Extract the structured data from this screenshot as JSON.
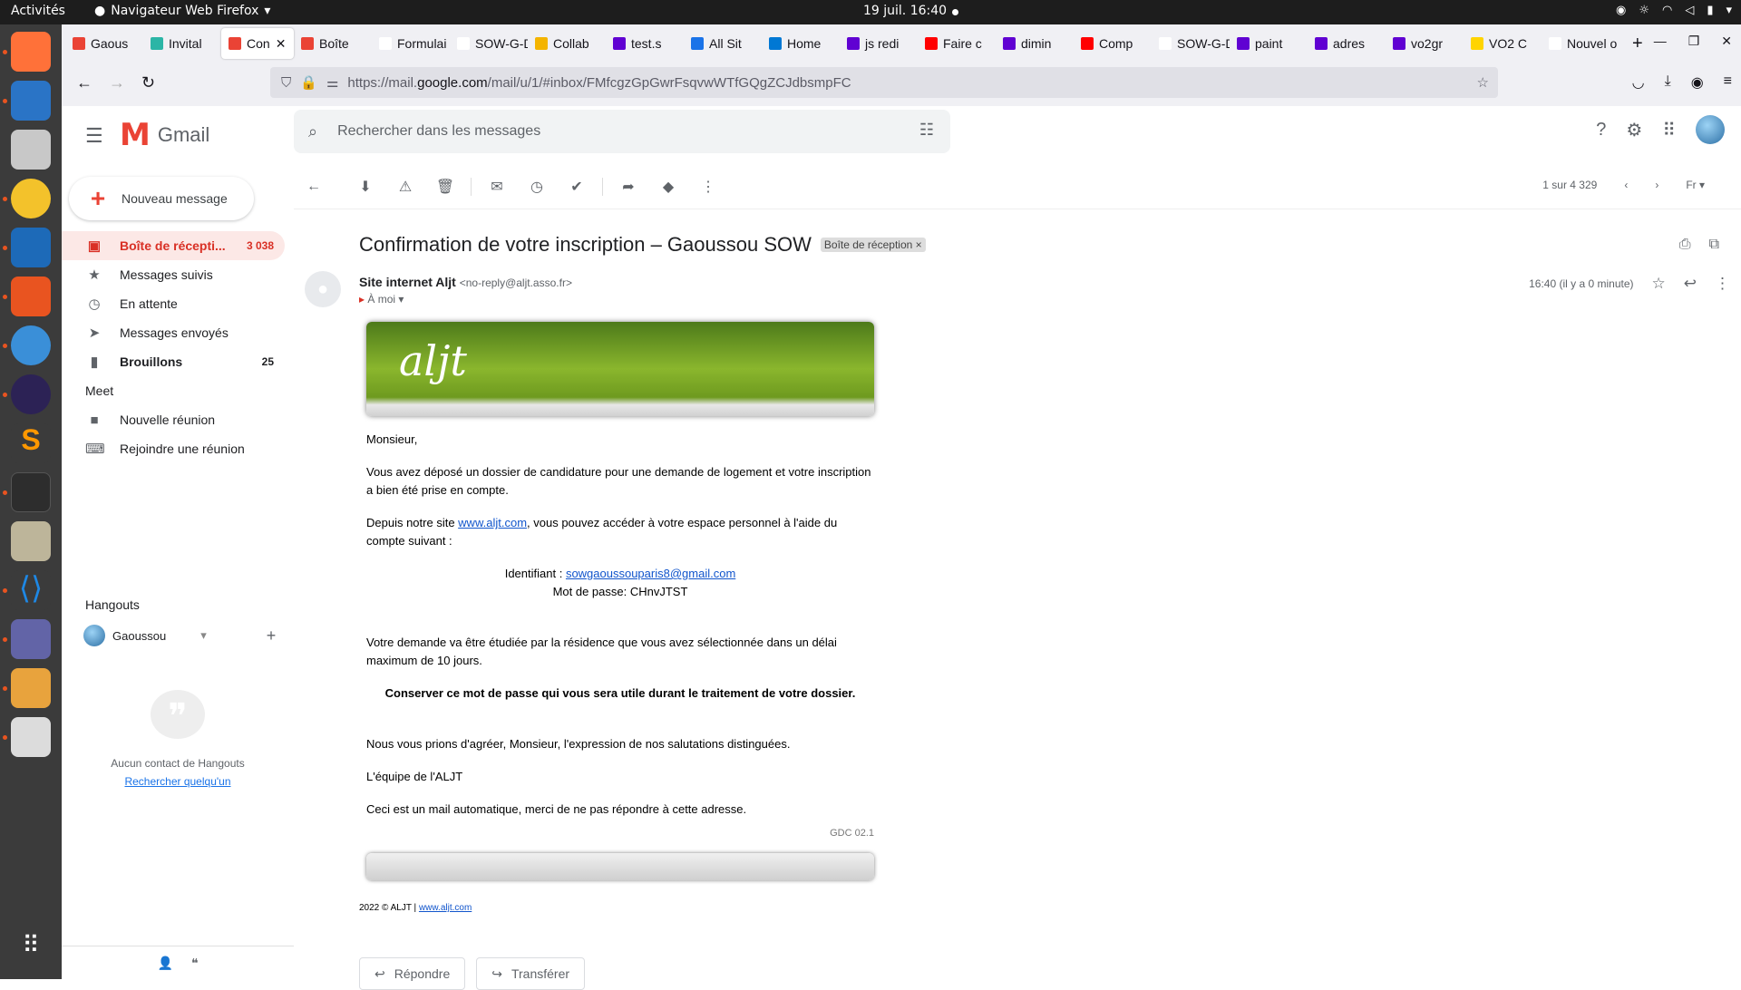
{
  "system": {
    "activities": "Activités",
    "app_name": "Navigateur Web Firefox",
    "clock": "19 juil.  16:40"
  },
  "browser": {
    "tabs": [
      {
        "label": "Gaous",
        "color": "#ea4335"
      },
      {
        "label": "Invital",
        "color": "#2bb5a6"
      },
      {
        "label": "Con",
        "color": "#ea4335",
        "active": true
      },
      {
        "label": "Boîte",
        "color": "#ea4335"
      },
      {
        "label": "Formulai",
        "color": "#ffffff"
      },
      {
        "label": "SOW-G-D",
        "color": "#ffffff"
      },
      {
        "label": "Collab",
        "color": "#f4b400"
      },
      {
        "label": "test.s",
        "color": "#6001d2"
      },
      {
        "label": "All Sit",
        "color": "#1a73e8"
      },
      {
        "label": "Home",
        "color": "#0078d4"
      },
      {
        "label": "js redi",
        "color": "#6001d2"
      },
      {
        "label": "Faire c",
        "color": "#ff0000"
      },
      {
        "label": "dimin",
        "color": "#6001d2"
      },
      {
        "label": "Comp",
        "color": "#ff0000"
      },
      {
        "label": "SOW-G-D",
        "color": "#ffffff"
      },
      {
        "label": "paint",
        "color": "#6001d2"
      },
      {
        "label": "adres",
        "color": "#6001d2"
      },
      {
        "label": "vo2gr",
        "color": "#6001d2"
      },
      {
        "label": "VO2 C",
        "color": "#ffd400"
      },
      {
        "label": "Nouvel o",
        "color": "#ffffff"
      }
    ],
    "url_prefix": "https://mail.",
    "url_domain": "google.com",
    "url_rest": "/mail/u/1/#inbox/FMfcgzGpGwrFsqvwWTfGQgZCJdbsmpFC"
  },
  "gmail": {
    "product": "Gmail",
    "search_placeholder": "Rechercher dans les messages",
    "compose": "Nouveau message",
    "nav": [
      {
        "label": "Boîte de récepti...",
        "count": "3 038",
        "icon": "▣",
        "selected": true
      },
      {
        "label": "Messages suivis",
        "count": "",
        "icon": "★"
      },
      {
        "label": "En attente",
        "count": "",
        "icon": "◷"
      },
      {
        "label": "Messages envoyés",
        "count": "",
        "icon": "➤"
      },
      {
        "label": "Brouillons",
        "count": "25",
        "icon": "▮",
        "bold": true
      }
    ],
    "meet_title": "Meet",
    "meet_items": [
      {
        "label": "Nouvelle réunion",
        "icon": "■"
      },
      {
        "label": "Rejoindre une réunion",
        "icon": "⌨"
      }
    ],
    "hangouts_title": "Hangouts",
    "hangouts_user": "Gaoussou",
    "hangouts_empty": "Aucun contact de Hangouts",
    "hangouts_search": "Rechercher quelqu'un",
    "pager": "1 sur 4 329"
  },
  "message": {
    "subject": "Confirmation de votre inscription – Gaoussou SOW",
    "label": "Boîte de réception",
    "sender_name": "Site internet Aljt",
    "sender_addr": "<no-reply@aljt.asso.fr>",
    "to": "À moi",
    "time": "16:40 (il y a 0 minute)",
    "logo": "aljt",
    "greeting": "Monsieur,",
    "p1": "Vous avez déposé un dossier de candidature pour une demande de logement et votre inscription a bien été prise en compte.",
    "p2_before": "Depuis notre site ",
    "p2_link": "www.aljt.com",
    "p2_after": ", vous pouvez accéder à votre espace personnel à l'aide du compte suivant :",
    "id_label": "Identifiant : ",
    "id_value": "sowgaoussouparis8@gmail.com",
    "pw_line": "Mot de passe: CHnvJTST",
    "p3": "Votre demande va être étudiée par la résidence que vous avez sélectionnée dans un délai maximum de 10 jours.",
    "p4": "Conserver ce mot de passe qui vous sera utile durant le traitement de votre dossier.",
    "p5": "Nous vous prions d'agréer, Monsieur, l'expression de nos salutations distinguées.",
    "p6": "L'équipe de l'ALJT",
    "p7": "Ceci est un mail automatique, merci de ne pas répondre à cette adresse.",
    "code": "GDC 02.1",
    "copyright": "2022 © ALJT   |   ",
    "copyright_link": "www.aljt.com",
    "reply": "Répondre",
    "forward": "Transférer"
  }
}
